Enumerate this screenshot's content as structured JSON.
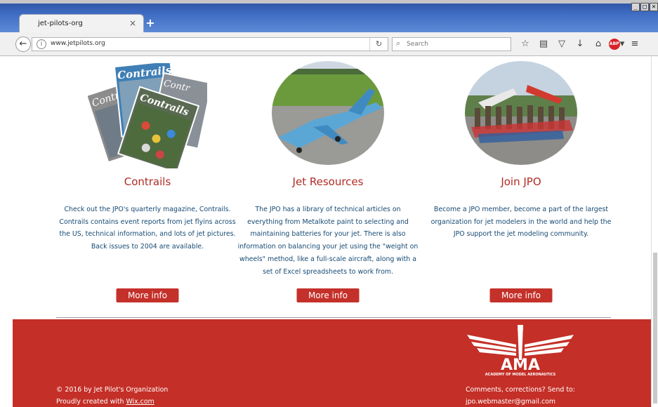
{
  "browser": {
    "tab_title": "jet-pilots-org",
    "tab_close": "×",
    "new_tab": "+",
    "url": "www.jetpilots.org",
    "search_placeholder": "Search",
    "window_controls": [
      "_",
      "□",
      "×"
    ]
  },
  "features": [
    {
      "title": "Contrails",
      "description": "Check out the JPO's quarterly magazine, Contrails. Contrails contains event reports from jet flyins across the US, technical information, and lots of jet pictures. Back issues to 2004 are available.",
      "button": "More info",
      "image_text": [
        "Contrails",
        "Contrails",
        "Contrails",
        "Contr"
      ]
    },
    {
      "title": "Jet Resources",
      "description": "The JPO has a library of technical articles on everything from Metalkote paint to selecting and maintaining batteries for your jet. There is also information on balancing your jet using the \"weight on wheels\" method, like a full-scale aircraft, along with a set of Excel spreadsheets to work from.",
      "button": "More info"
    },
    {
      "title": "Join JPO",
      "description": "Become a JPO member, become a part of the largest organization for jet modelers in the world and help the JPO support the jet modeling community.",
      "button": "More info"
    }
  ],
  "footer": {
    "copyright": "© 2016 by Jet Pilot's Organization",
    "created_prefix": "Proudly created with ",
    "created_link": "Wix.com",
    "contact_label": "Comments, corrections? Send to:",
    "contact_email": "jpo.webmaster@gmail.com",
    "logo_text": "AMA",
    "logo_subtext": "ACADEMY OF MODEL AERONAUTICS"
  },
  "colors": {
    "accent_red": "#c42f27",
    "heading_red": "#b22b25",
    "body_blue": "#164a73"
  }
}
